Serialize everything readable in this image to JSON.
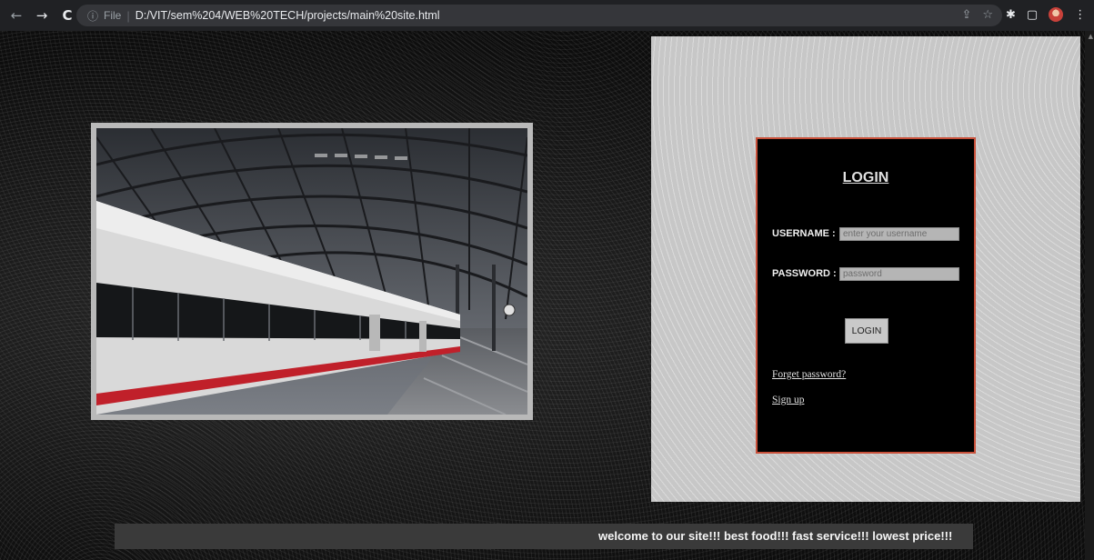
{
  "browser": {
    "back_glyph": "←",
    "forward_glyph": "→",
    "reload_glyph": "C",
    "info_glyph": "ⓘ",
    "scheme": "File",
    "separator": "|",
    "url": "D:/VIT/sem%204/WEB%20TECH/projects/main%20site.html",
    "share_glyph": "⇪",
    "star_glyph": "☆",
    "extensions_glyph": "✱",
    "sidepanel_glyph": "▢",
    "menu_glyph": "⋮",
    "scroll_up_glyph": "▲"
  },
  "login": {
    "title": "LOGIN",
    "username_label": "USERNAME :",
    "username_placeholder": "enter your username",
    "password_label": "PASSWORD :",
    "password_placeholder": "password",
    "button_label": "LOGIN",
    "forgot_link": "Forget password?",
    "signup_link": "Sign up"
  },
  "marquee": {
    "text": "welcome to our site!!! best food!!! fast service!!! lowest price!!!"
  },
  "colors": {
    "login_border": "#c8503a",
    "train_stripe": "#c0202a"
  }
}
